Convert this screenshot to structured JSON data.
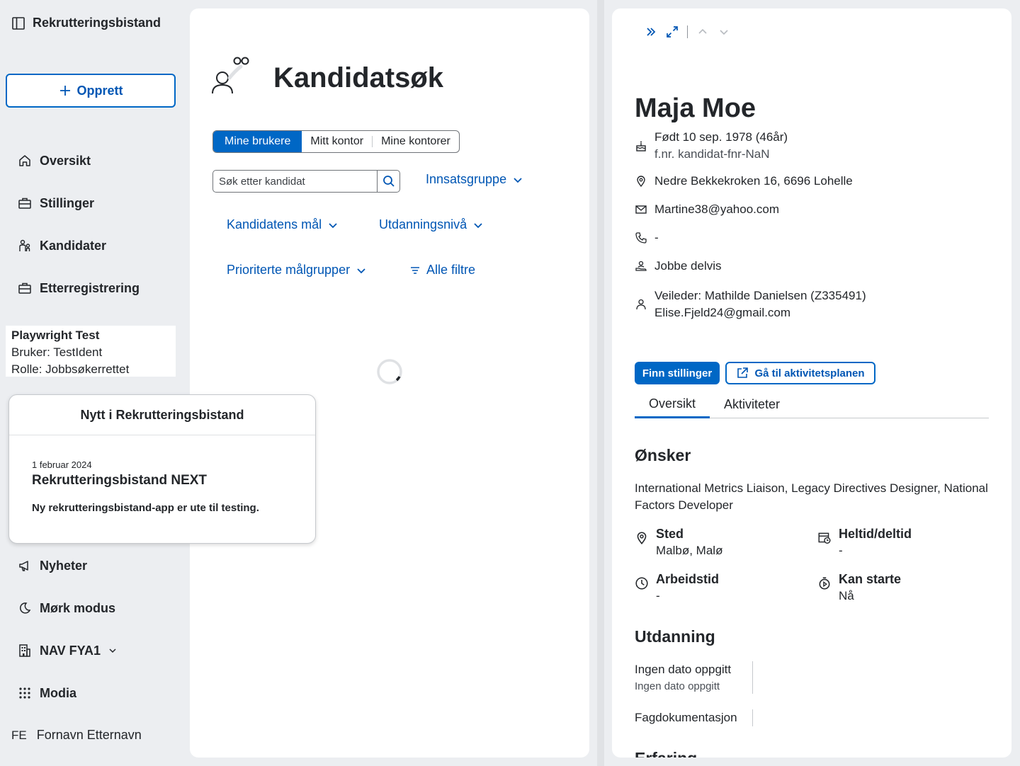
{
  "sidebar": {
    "app_title": "Rekrutteringsbistand",
    "create_label": "Opprett",
    "nav": {
      "overview": "Oversikt",
      "jobs": "Stillinger",
      "candidates": "Kandidater",
      "post_registration": "Etterregistrering",
      "news": "Nyheter",
      "dark_mode": "Mørk modus",
      "office": "NAV FYA1",
      "modia": "Modia"
    },
    "user_card": {
      "name": "Playwright Test",
      "user": "Bruker: TestIdent",
      "role": "Rolle: Jobbsøkerrettet"
    },
    "avatar_initials": "FE",
    "avatar_name": "Fornavn Etternavn"
  },
  "popover": {
    "title": "Nytt i Rekrutteringsbistand",
    "date": "1 februar 2024",
    "headline": "Rekrutteringsbistand NEXT",
    "body": "Ny rekrutteringsbistand-app er ute til testing."
  },
  "search_panel": {
    "title": "Kandidatsøk",
    "toggle": [
      "Mine brukere",
      "Mitt kontor",
      "Mine kontorer"
    ],
    "search_placeholder": "Søk etter kandidat",
    "filters": {
      "effort_group": "Innsatsgruppe",
      "candidate_goal": "Kandidatens mål",
      "education_level": "Utdanningsnivå",
      "priority_groups": "Prioriterte målgrupper",
      "all_filters": "Alle filtre"
    }
  },
  "candidate": {
    "name": "Maja Moe",
    "born": "Født 10 sep. 1978 (46år)",
    "fnr": "f.nr. kandidat-fnr-NaN",
    "address": "Nedre Bekkekroken 16, 6696 Lohelle",
    "email": "Martine38@yahoo.com",
    "phone": "-",
    "work_status": "Jobbe delvis",
    "supervisor": "Veileder: Mathilde Danielsen (Z335491)",
    "supervisor_email": "Elise.Fjeld24@gmail.com",
    "find_jobs_label": "Finn stillinger",
    "activity_plan_label": "Gå til aktivitetsplanen",
    "tabs": [
      "Oversikt",
      "Aktiviteter"
    ],
    "wishes_title": "Ønsker",
    "wishes_text": "International Metrics Liaison, Legacy Directives Designer, National Factors Developer",
    "place_label": "Sted",
    "place_value": "Malbø, Malø",
    "fulltime_label": "Heltid/deltid",
    "fulltime_value": "-",
    "worktime_label": "Arbeidstid",
    "worktime_value": "-",
    "start_label": "Kan starte",
    "start_value": "Nå",
    "education_title": "Utdanning",
    "edu_1_main": "Ingen dato oppgitt",
    "edu_1_sub": "Ingen dato oppgitt",
    "edu_2_main": "Fagdokumentasjon",
    "next_section_partial": "Erfaring"
  },
  "colors": {
    "accent": "#0067c5",
    "link": "#0056b4",
    "background": "#eceef1",
    "panel": "#ffffff"
  }
}
